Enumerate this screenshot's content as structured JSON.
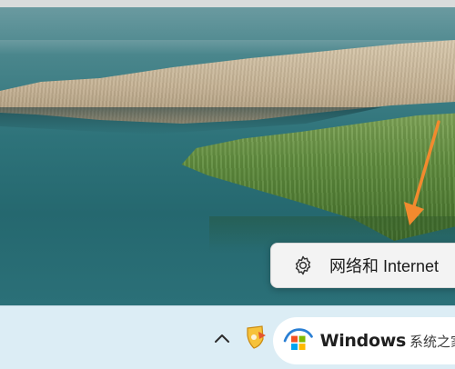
{
  "flyout": {
    "label": "网络和 Internet",
    "icon": "gear-icon"
  },
  "taskbar": {
    "chevron_icon": "chevron-up-icon",
    "tray_app_icon": "shield-app-icon"
  },
  "watermark": {
    "brand": "Windows",
    "brand_suffix": "系统之家"
  },
  "colors": {
    "accent_arrow": "#f28a2e",
    "taskbar_bg": "#dcedf5",
    "flyout_bg": "#f3f3f3"
  }
}
